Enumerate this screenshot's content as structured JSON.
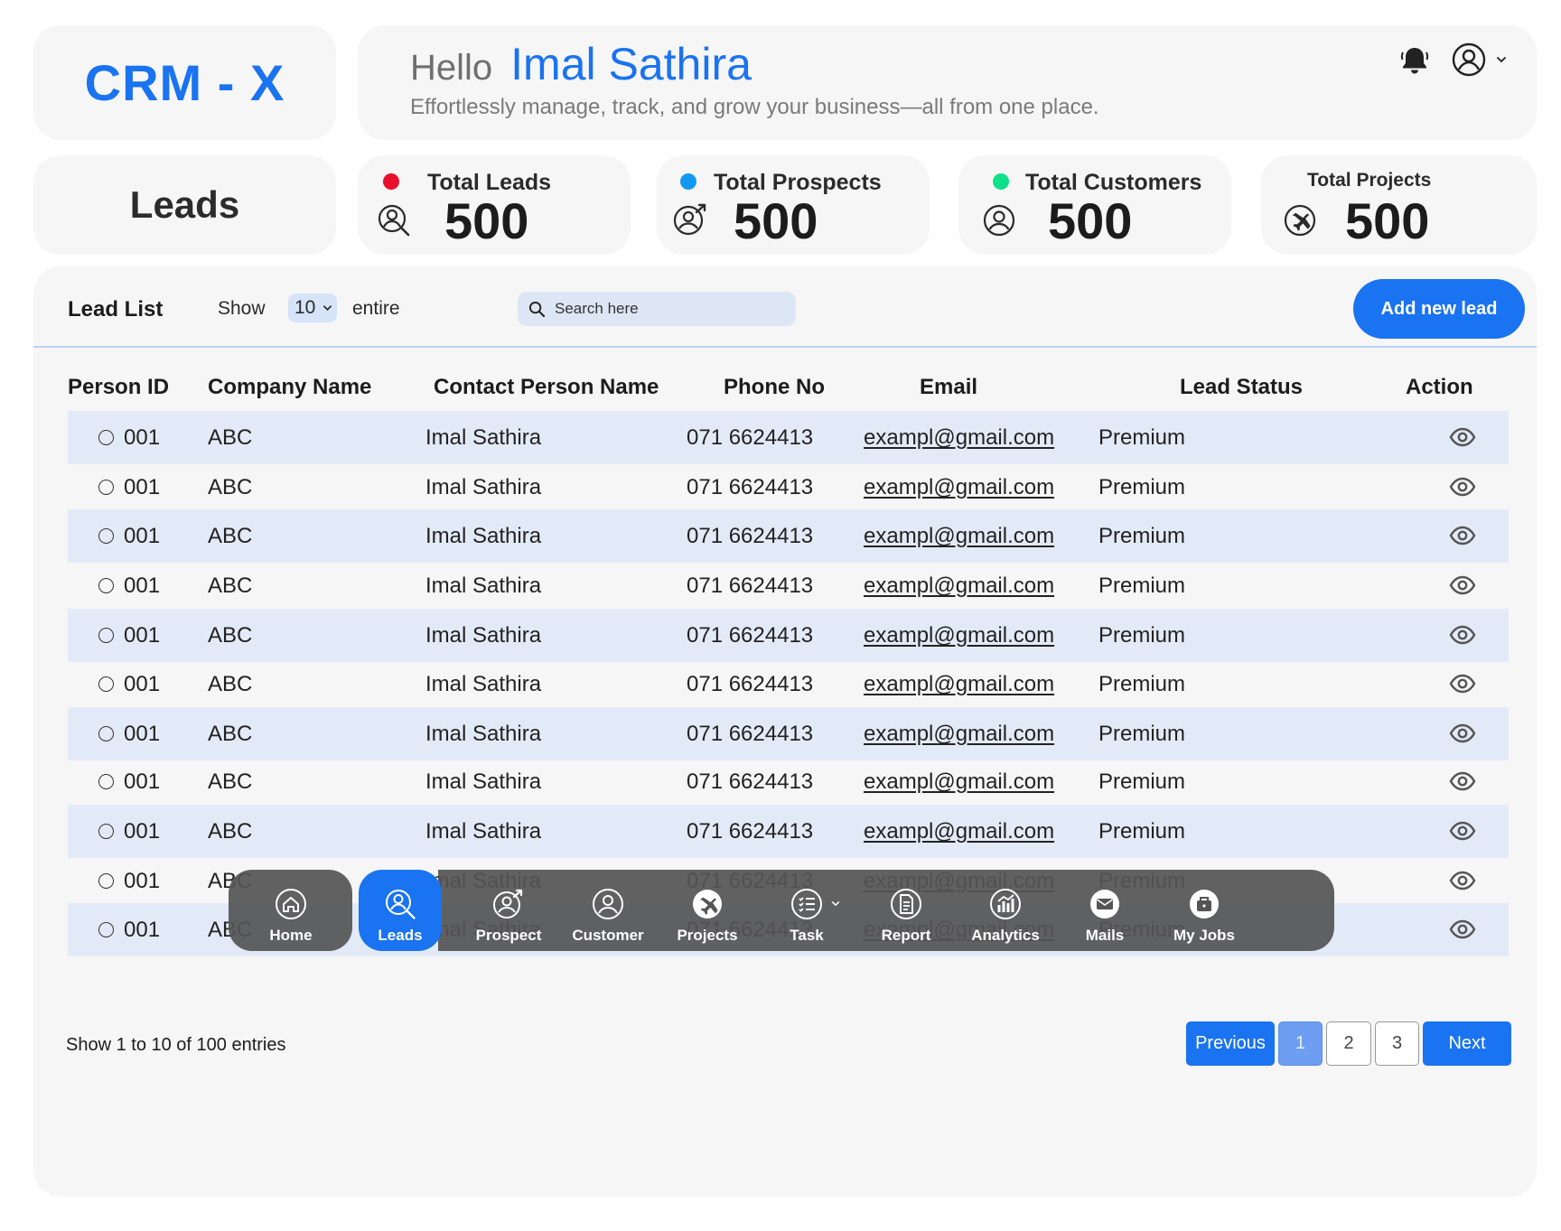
{
  "app": {
    "logo": "CRM - X"
  },
  "header": {
    "greeting": "Hello",
    "user_name": "Imal Sathira",
    "tagline": "Effortlessly manage, track, and grow your business—all from one place."
  },
  "page": {
    "title": "Leads"
  },
  "stats": [
    {
      "label": "Total Leads",
      "value": "500",
      "dot_color": "#e8102a",
      "icon": "user-search-icon"
    },
    {
      "label": "Total Prospects",
      "value": "500",
      "dot_color": "#1298f0",
      "icon": "user-arrow-icon"
    },
    {
      "label": "Total Customers",
      "value": "500",
      "dot_color": "#10e08a",
      "icon": "user-icon"
    },
    {
      "label": "Total Projects",
      "value": "500",
      "dot_color": "",
      "icon": "plane-icon"
    }
  ],
  "lead_list": {
    "title": "Lead List",
    "show_label": "Show",
    "page_size": "10",
    "entire_label": "entire",
    "search_placeholder": "Search here",
    "add_button": "Add new lead"
  },
  "table": {
    "columns": [
      "Person ID",
      "Company Name",
      "Contact Person Name",
      "Phone No",
      "Email",
      "Lead Status",
      "Action"
    ],
    "rows": [
      {
        "id": "001",
        "company": "ABC",
        "contact": "Imal Sathira",
        "phone": "071 6624413",
        "email": "exampl@gmail.com",
        "status": "Premium"
      },
      {
        "id": "001",
        "company": "ABC",
        "contact": "Imal Sathira",
        "phone": "071 6624413",
        "email": "exampl@gmail.com",
        "status": "Premium"
      },
      {
        "id": "001",
        "company": "ABC",
        "contact": "Imal Sathira",
        "phone": "071 6624413",
        "email": "exampl@gmail.com",
        "status": "Premium"
      },
      {
        "id": "001",
        "company": "ABC",
        "contact": "Imal Sathira",
        "phone": "071 6624413",
        "email": "exampl@gmail.com",
        "status": "Premium"
      },
      {
        "id": "001",
        "company": "ABC",
        "contact": "Imal Sathira",
        "phone": "071 6624413",
        "email": "exampl@gmail.com",
        "status": "Premium"
      },
      {
        "id": "001",
        "company": "ABC",
        "contact": "Imal Sathira",
        "phone": "071 6624413",
        "email": "exampl@gmail.com",
        "status": "Premium"
      },
      {
        "id": "001",
        "company": "ABC",
        "contact": "Imal Sathira",
        "phone": "071 6624413",
        "email": "exampl@gmail.com",
        "status": "Premium"
      },
      {
        "id": "001",
        "company": "ABC",
        "contact": "Imal Sathira",
        "phone": "071 6624413",
        "email": "exampl@gmail.com",
        "status": "Premium"
      },
      {
        "id": "001",
        "company": "ABC",
        "contact": "Imal Sathira",
        "phone": "071 6624413",
        "email": "exampl@gmail.com",
        "status": "Premium"
      },
      {
        "id": "001",
        "company": "ABC",
        "contact": "Imal Sathira",
        "phone": "071 6624413",
        "email": "exampl@gmail.com",
        "status": "Premium"
      },
      {
        "id": "001",
        "company": "ABC",
        "contact": "Imal Sathira",
        "phone": "071 6624413",
        "email": "exampl@gmail.com",
        "status": "Premium"
      }
    ]
  },
  "footer": {
    "entries_info": "Show 1 to 10 of 100 entries",
    "previous": "Previous",
    "pages": [
      "1",
      "2",
      "3"
    ],
    "current_page": "1",
    "next": "Next"
  },
  "bottom_nav": {
    "active": "Leads",
    "items": [
      {
        "label": "Home",
        "icon": "home-icon"
      },
      {
        "label": "Leads",
        "icon": "user-search-icon"
      },
      {
        "label": "Prospect",
        "icon": "user-arrow-icon"
      },
      {
        "label": "Customer",
        "icon": "user-icon"
      },
      {
        "label": "Projects",
        "icon": "plane-icon"
      },
      {
        "label": "Task",
        "icon": "checklist-icon"
      },
      {
        "label": "Report",
        "icon": "report-icon"
      },
      {
        "label": "Analytics",
        "icon": "analytics-icon"
      },
      {
        "label": "Mails",
        "icon": "mail-icon"
      },
      {
        "label": "My Jobs",
        "icon": "briefcase-icon"
      }
    ]
  },
  "colors": {
    "accent": "#1a73f0",
    "card_bg": "#f6f6f6",
    "row_alt": "#e3eaf7",
    "nav_bg": "#555555"
  }
}
